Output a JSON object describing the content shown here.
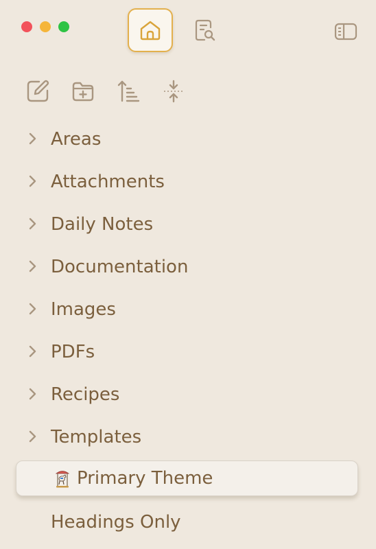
{
  "window": {
    "traffic_lights": [
      "close",
      "minimize",
      "maximize"
    ]
  },
  "tabs": [
    {
      "icon": "home-icon",
      "active": true
    },
    {
      "icon": "search-document-icon",
      "active": false
    }
  ],
  "toolbar": {
    "icons": [
      "new-note-icon",
      "new-folder-icon",
      "sort-icon",
      "collapse-all-icon"
    ]
  },
  "tree": {
    "folders": [
      {
        "label": "Areas"
      },
      {
        "label": "Attachments"
      },
      {
        "label": "Daily Notes"
      },
      {
        "label": "Documentation"
      },
      {
        "label": "Images"
      },
      {
        "label": "PDFs"
      },
      {
        "label": "Recipes"
      },
      {
        "label": "Templates"
      }
    ],
    "selected_note": {
      "label": "Primary Theme",
      "icon": "carousel-horse-icon"
    },
    "notes": [
      {
        "label": "Headings Only"
      }
    ]
  },
  "colors": {
    "background": "#efe8de",
    "text": "#7b5f3d",
    "accent": "#e3b04d",
    "icon": "#a99680"
  }
}
